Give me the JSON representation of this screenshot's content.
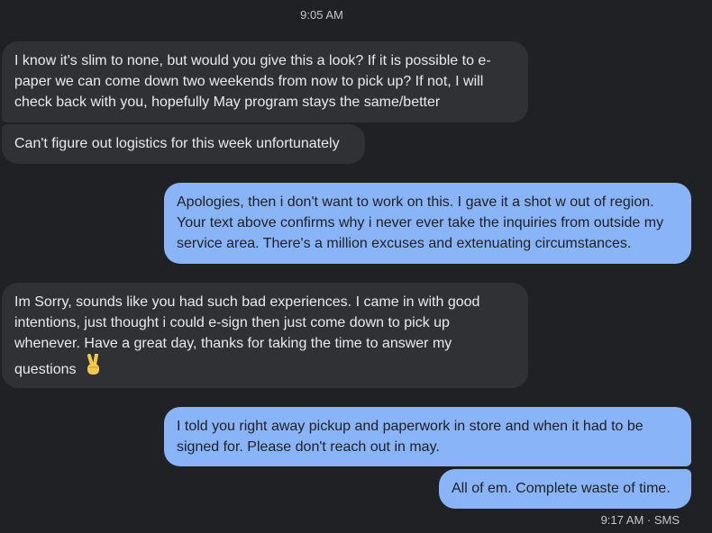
{
  "thread": {
    "time_top": "9:05 AM",
    "messages": [
      {
        "direction": "incoming",
        "text": "I know it's slim to none, but would you give this a look? If it is possible to e-paper we can come down two weekends from now to pick up? If not, I will check back with you, hopefully May program stays the same/better"
      },
      {
        "direction": "incoming",
        "text": "Can't figure out logistics for this week unfortunately"
      },
      {
        "direction": "outgoing",
        "text": "Apologies, then i don't want to work on this. I gave it a shot w out of region. Your text above confirms why i never ever take the inquiries from outside my service area. There's a million excuses and extenuating circumstances."
      },
      {
        "direction": "incoming",
        "text": "Im Sorry, sounds like you had such bad experiences. I came in with good intentions, just thought i could e-sign then just come down to pick up whenever. Have a great day, thanks for taking the time to answer my questions",
        "emoji": "victory-hand"
      },
      {
        "direction": "outgoing",
        "text": "I told you right away pickup and paperwork in store and when it had to be signed for. Please don't reach out in may."
      },
      {
        "direction": "outgoing",
        "text": "All of em. Complete waste of time."
      }
    ],
    "last_meta": "9:17 AM · SMS"
  },
  "colors": {
    "background": "#202124",
    "incoming_bubble": "#303134",
    "outgoing_bubble": "#8ab4f8"
  }
}
